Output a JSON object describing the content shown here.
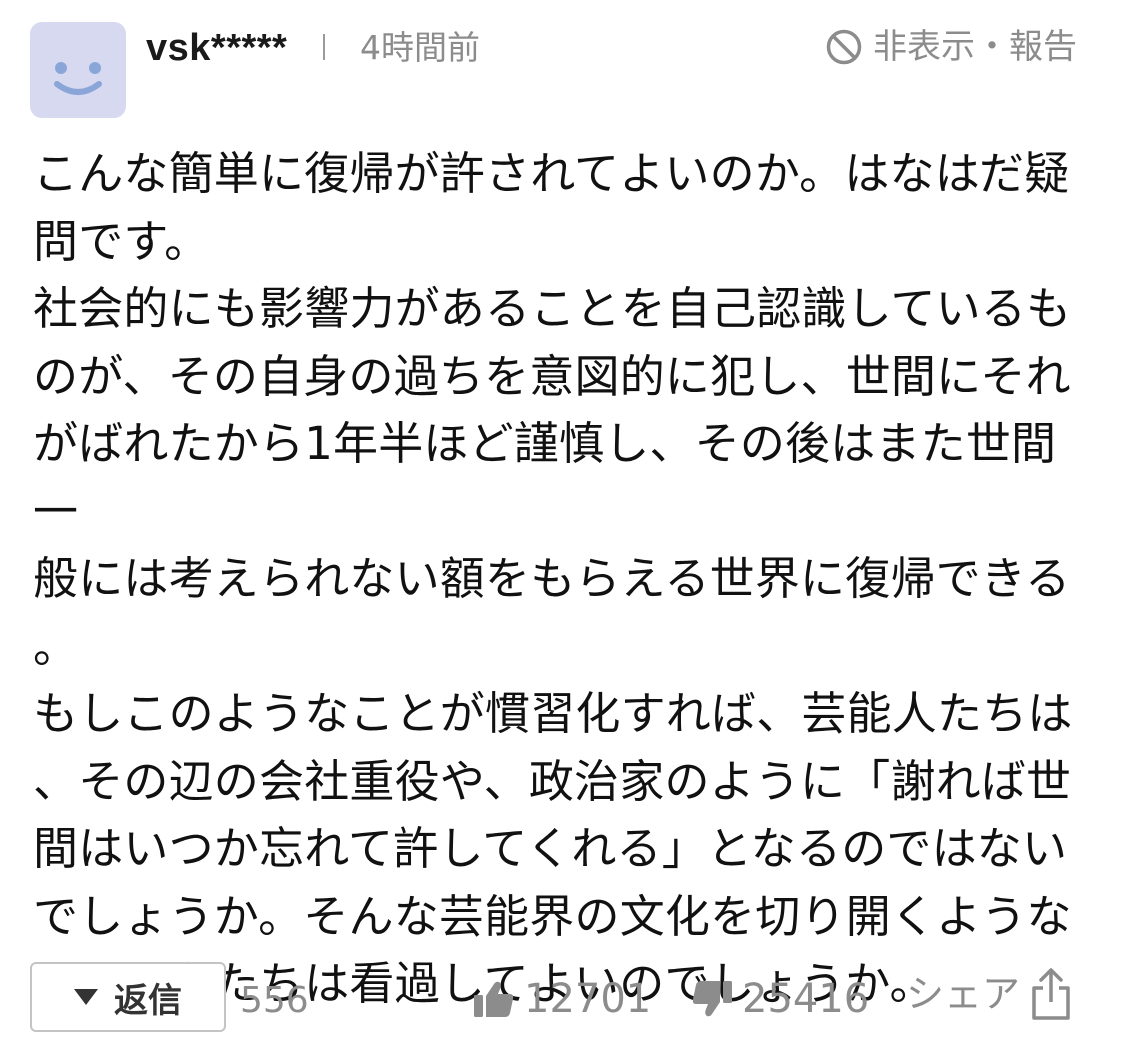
{
  "header": {
    "username": "vsk*****",
    "timestamp": "4時間前",
    "hide_report": "非表示・報告",
    "avatar_icon": "smiley-face-icon",
    "hide_icon": "prohibited-circle-icon"
  },
  "comment": {
    "text": "こんな簡単に復帰が許されてよいのか。はなはだ疑\n問です。\n社会的にも影響力があることを自己認識しているも\nのが、その自身の過ちを意図的に犯し、世間にそれ\nがばれたから1年半ほど謹慎し、その後はまた世間一\n般には考えられない額をもらえる世界に復帰できる\n。\nもしこのようなことが慣習化すれば、芸能人たちは\n、その辺の会社重役や、政治家のように「謝れば世\n間はいつか忘れて許してくれる」となるのではない\nでしょうか。そんな芸能界の文化を切り開くような\nことを私たちは看過してよいのでしょうか。"
  },
  "footer": {
    "reply_label": "返信",
    "reply_count": "556",
    "likes": "12701",
    "dislikes": "25416",
    "share_label": "シェア",
    "icons": [
      "triangle-down-icon",
      "thumbs-up-icon",
      "thumbs-down-icon",
      "share-icon"
    ]
  },
  "colors": {
    "avatar_bg": "#d6d9ef",
    "avatar_face": "#8aa6d8",
    "muted_text": "#8c8c8c",
    "body_text": "#111111"
  }
}
